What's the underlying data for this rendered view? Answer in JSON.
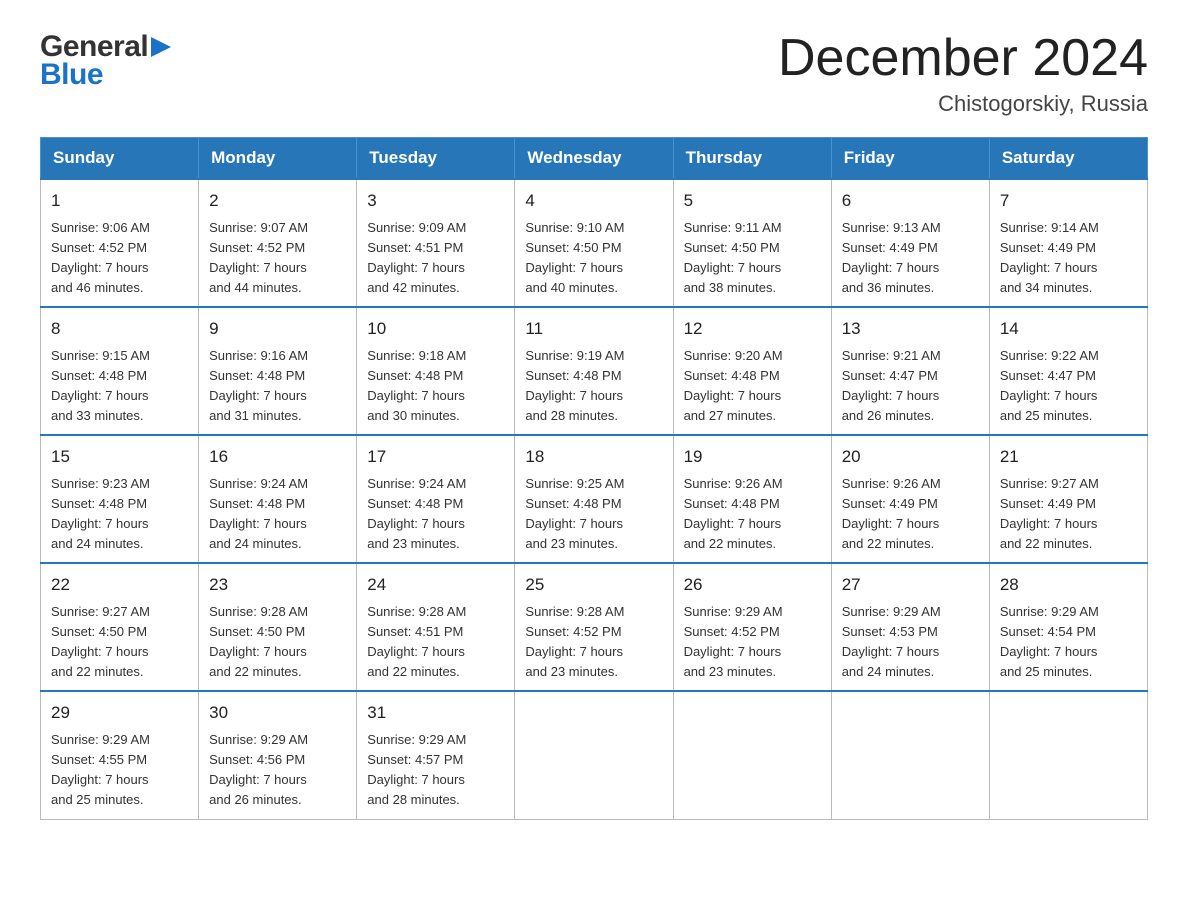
{
  "header": {
    "logo": {
      "general": "General",
      "blue": "Blue"
    },
    "title": "December 2024",
    "location": "Chistogorskiy, Russia"
  },
  "calendar": {
    "headers": [
      "Sunday",
      "Monday",
      "Tuesday",
      "Wednesday",
      "Thursday",
      "Friday",
      "Saturday"
    ],
    "weeks": [
      [
        {
          "day": "1",
          "info": "Sunrise: 9:06 AM\nSunset: 4:52 PM\nDaylight: 7 hours\nand 46 minutes."
        },
        {
          "day": "2",
          "info": "Sunrise: 9:07 AM\nSunset: 4:52 PM\nDaylight: 7 hours\nand 44 minutes."
        },
        {
          "day": "3",
          "info": "Sunrise: 9:09 AM\nSunset: 4:51 PM\nDaylight: 7 hours\nand 42 minutes."
        },
        {
          "day": "4",
          "info": "Sunrise: 9:10 AM\nSunset: 4:50 PM\nDaylight: 7 hours\nand 40 minutes."
        },
        {
          "day": "5",
          "info": "Sunrise: 9:11 AM\nSunset: 4:50 PM\nDaylight: 7 hours\nand 38 minutes."
        },
        {
          "day": "6",
          "info": "Sunrise: 9:13 AM\nSunset: 4:49 PM\nDaylight: 7 hours\nand 36 minutes."
        },
        {
          "day": "7",
          "info": "Sunrise: 9:14 AM\nSunset: 4:49 PM\nDaylight: 7 hours\nand 34 minutes."
        }
      ],
      [
        {
          "day": "8",
          "info": "Sunrise: 9:15 AM\nSunset: 4:48 PM\nDaylight: 7 hours\nand 33 minutes."
        },
        {
          "day": "9",
          "info": "Sunrise: 9:16 AM\nSunset: 4:48 PM\nDaylight: 7 hours\nand 31 minutes."
        },
        {
          "day": "10",
          "info": "Sunrise: 9:18 AM\nSunset: 4:48 PM\nDaylight: 7 hours\nand 30 minutes."
        },
        {
          "day": "11",
          "info": "Sunrise: 9:19 AM\nSunset: 4:48 PM\nDaylight: 7 hours\nand 28 minutes."
        },
        {
          "day": "12",
          "info": "Sunrise: 9:20 AM\nSunset: 4:48 PM\nDaylight: 7 hours\nand 27 minutes."
        },
        {
          "day": "13",
          "info": "Sunrise: 9:21 AM\nSunset: 4:47 PM\nDaylight: 7 hours\nand 26 minutes."
        },
        {
          "day": "14",
          "info": "Sunrise: 9:22 AM\nSunset: 4:47 PM\nDaylight: 7 hours\nand 25 minutes."
        }
      ],
      [
        {
          "day": "15",
          "info": "Sunrise: 9:23 AM\nSunset: 4:48 PM\nDaylight: 7 hours\nand 24 minutes."
        },
        {
          "day": "16",
          "info": "Sunrise: 9:24 AM\nSunset: 4:48 PM\nDaylight: 7 hours\nand 24 minutes."
        },
        {
          "day": "17",
          "info": "Sunrise: 9:24 AM\nSunset: 4:48 PM\nDaylight: 7 hours\nand 23 minutes."
        },
        {
          "day": "18",
          "info": "Sunrise: 9:25 AM\nSunset: 4:48 PM\nDaylight: 7 hours\nand 23 minutes."
        },
        {
          "day": "19",
          "info": "Sunrise: 9:26 AM\nSunset: 4:48 PM\nDaylight: 7 hours\nand 22 minutes."
        },
        {
          "day": "20",
          "info": "Sunrise: 9:26 AM\nSunset: 4:49 PM\nDaylight: 7 hours\nand 22 minutes."
        },
        {
          "day": "21",
          "info": "Sunrise: 9:27 AM\nSunset: 4:49 PM\nDaylight: 7 hours\nand 22 minutes."
        }
      ],
      [
        {
          "day": "22",
          "info": "Sunrise: 9:27 AM\nSunset: 4:50 PM\nDaylight: 7 hours\nand 22 minutes."
        },
        {
          "day": "23",
          "info": "Sunrise: 9:28 AM\nSunset: 4:50 PM\nDaylight: 7 hours\nand 22 minutes."
        },
        {
          "day": "24",
          "info": "Sunrise: 9:28 AM\nSunset: 4:51 PM\nDaylight: 7 hours\nand 22 minutes."
        },
        {
          "day": "25",
          "info": "Sunrise: 9:28 AM\nSunset: 4:52 PM\nDaylight: 7 hours\nand 23 minutes."
        },
        {
          "day": "26",
          "info": "Sunrise: 9:29 AM\nSunset: 4:52 PM\nDaylight: 7 hours\nand 23 minutes."
        },
        {
          "day": "27",
          "info": "Sunrise: 9:29 AM\nSunset: 4:53 PM\nDaylight: 7 hours\nand 24 minutes."
        },
        {
          "day": "28",
          "info": "Sunrise: 9:29 AM\nSunset: 4:54 PM\nDaylight: 7 hours\nand 25 minutes."
        }
      ],
      [
        {
          "day": "29",
          "info": "Sunrise: 9:29 AM\nSunset: 4:55 PM\nDaylight: 7 hours\nand 25 minutes."
        },
        {
          "day": "30",
          "info": "Sunrise: 9:29 AM\nSunset: 4:56 PM\nDaylight: 7 hours\nand 26 minutes."
        },
        {
          "day": "31",
          "info": "Sunrise: 9:29 AM\nSunset: 4:57 PM\nDaylight: 7 hours\nand 28 minutes."
        },
        {
          "day": "",
          "info": ""
        },
        {
          "day": "",
          "info": ""
        },
        {
          "day": "",
          "info": ""
        },
        {
          "day": "",
          "info": ""
        }
      ]
    ]
  }
}
